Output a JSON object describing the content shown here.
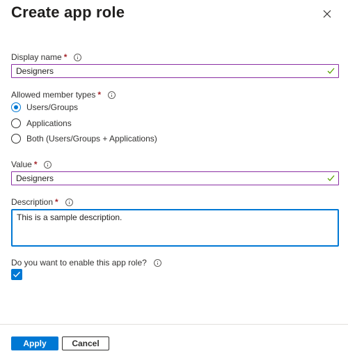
{
  "panel": {
    "title": "Create app role"
  },
  "display_name": {
    "label": "Display name",
    "required_mark": "*",
    "value": "Designers"
  },
  "member_types": {
    "label": "Allowed member types",
    "required_mark": "*",
    "options": [
      {
        "label": "Users/Groups",
        "selected": true
      },
      {
        "label": "Applications",
        "selected": false
      },
      {
        "label": "Both (Users/Groups + Applications)",
        "selected": false
      }
    ]
  },
  "value_field": {
    "label": "Value",
    "required_mark": "*",
    "value": "Designers"
  },
  "description": {
    "label": "Description",
    "required_mark": "*",
    "value": "This is a sample description."
  },
  "enable": {
    "label": "Do you want to enable this app role?",
    "checked": true
  },
  "footer": {
    "apply_label": "Apply",
    "cancel_label": "Cancel"
  },
  "colors": {
    "accent": "#0078d4",
    "valid_border": "#8a2fa3",
    "valid_check": "#57a300",
    "required": "#a4262c"
  },
  "icons": {
    "close": "close-icon",
    "info": "info-icon",
    "valid": "checkmark-icon"
  }
}
